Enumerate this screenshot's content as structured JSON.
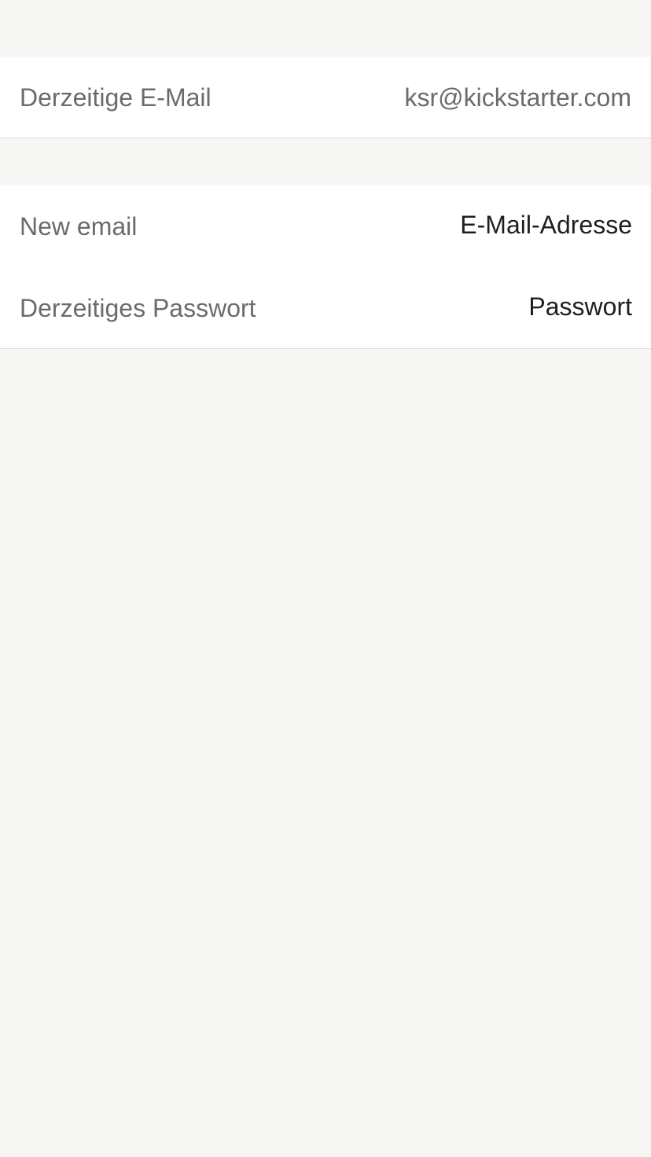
{
  "current_email": {
    "label": "Derzeitige E-Mail",
    "value": "ksr@kickstarter.com"
  },
  "form": {
    "new_email": {
      "label": "New email",
      "placeholder": "E-Mail-Adresse"
    },
    "current_password": {
      "label": "Derzeitiges Passwort",
      "placeholder": "Passwort"
    }
  },
  "colors": {
    "background": "#f6f6f4",
    "surface": "#ffffff",
    "label_text": "#6b6b6b",
    "input_text": "#1f1f1f",
    "divider": "#dcdcdc"
  }
}
